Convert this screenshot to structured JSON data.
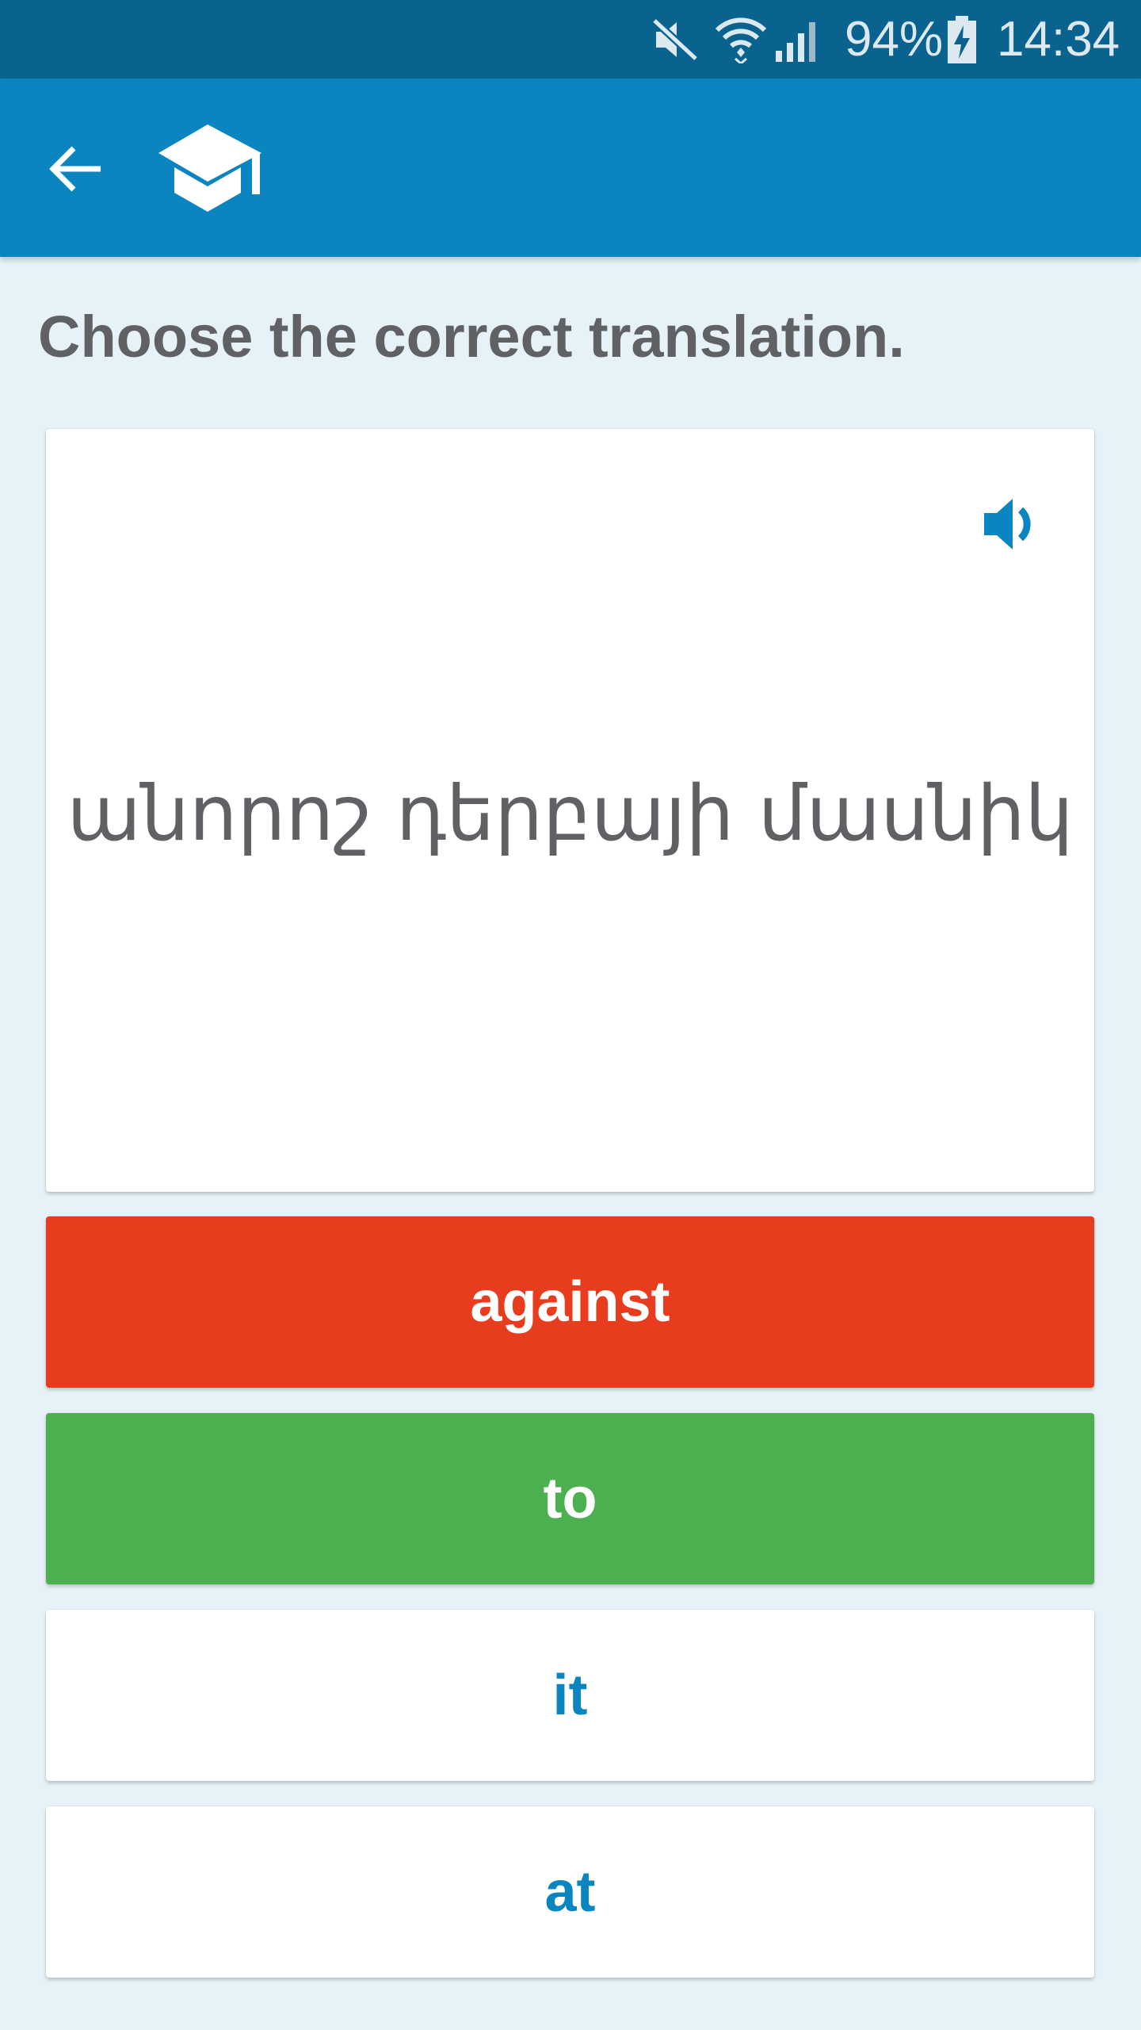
{
  "status_bar": {
    "battery_percent": "94%",
    "time": "14:34",
    "icons": [
      "mute-icon",
      "wifi-icon",
      "signal-icon",
      "battery-charging-icon"
    ]
  },
  "app_bar": {
    "icons": [
      "back-arrow-icon",
      "graduation-cap-icon"
    ]
  },
  "instruction": "Choose the correct translation.",
  "prompt": {
    "word": "անորոշ դերբայի մասնիկ",
    "speaker_icon": "speaker-icon"
  },
  "options": [
    {
      "label": "against",
      "state": "wrong"
    },
    {
      "label": "to",
      "state": "correct"
    },
    {
      "label": "it",
      "state": "default"
    },
    {
      "label": "at",
      "state": "default"
    }
  ],
  "colors": {
    "status_bar": "#0a638f",
    "app_bar": "#0b85c0",
    "background": "#e6f2f8",
    "wrong": "#e83c1f",
    "correct": "#4caf50",
    "default_option_bg": "#ffffff",
    "default_option_text": "#0b85c0",
    "text_gray": "#5f6164"
  }
}
